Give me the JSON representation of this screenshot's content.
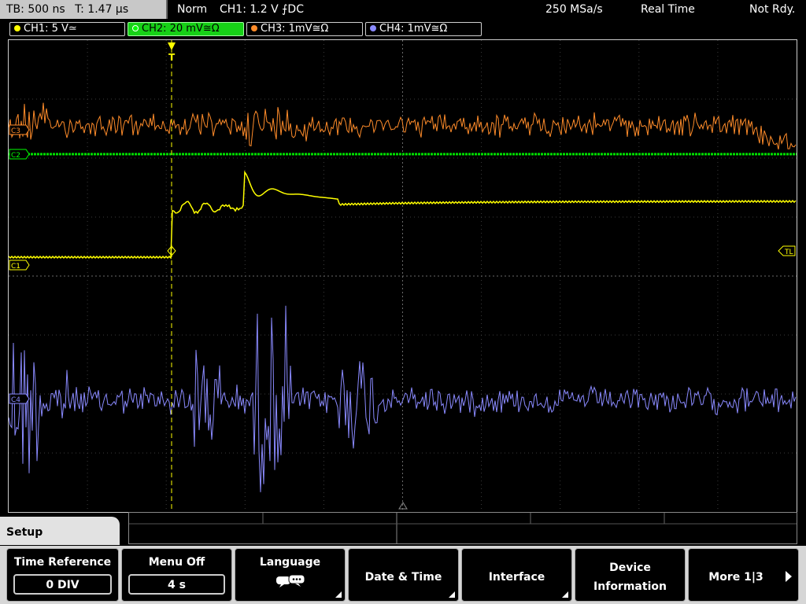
{
  "top": {
    "timebase": "TB: 500 ns",
    "trigger_time": "T: 1.47 µs",
    "mode": "Norm",
    "trigger_info": "CH1: 1.2 V ⨍DC",
    "sample_rate": "250 MSa/s",
    "acq_mode": "Real Time",
    "status": "Not Rdy."
  },
  "channels": [
    {
      "label": "CH1: 5 V≃",
      "color": "#ffff00",
      "active": false
    },
    {
      "label": "CH2: 20 mV≅Ω",
      "color": "#00ff00",
      "active": true
    },
    {
      "label": "CH3: 1mV≅Ω",
      "color": "#ff8c2a",
      "active": false
    },
    {
      "label": "CH4: 1mV≅Ω",
      "color": "#8a8aff",
      "active": false
    }
  ],
  "markers": {
    "c3": "C3",
    "c2": "C2",
    "c1": "C1",
    "c4": "C4",
    "tl": "TL",
    "trigger": "T"
  },
  "menu": {
    "tab": "Setup",
    "time_reference_label": "Time Reference",
    "time_reference_value": "0 DIV",
    "menu_off_label": "Menu Off",
    "menu_off_value": "4 s",
    "language_label": "Language",
    "date_time_label": "Date & Time",
    "interface_label": "Interface",
    "device_info_label_1": "Device",
    "device_info_label_2": "Information",
    "more_label": "More 1|3"
  },
  "icons": {
    "language": "speech-bubbles-icon",
    "more": "arrow-right-icon"
  }
}
